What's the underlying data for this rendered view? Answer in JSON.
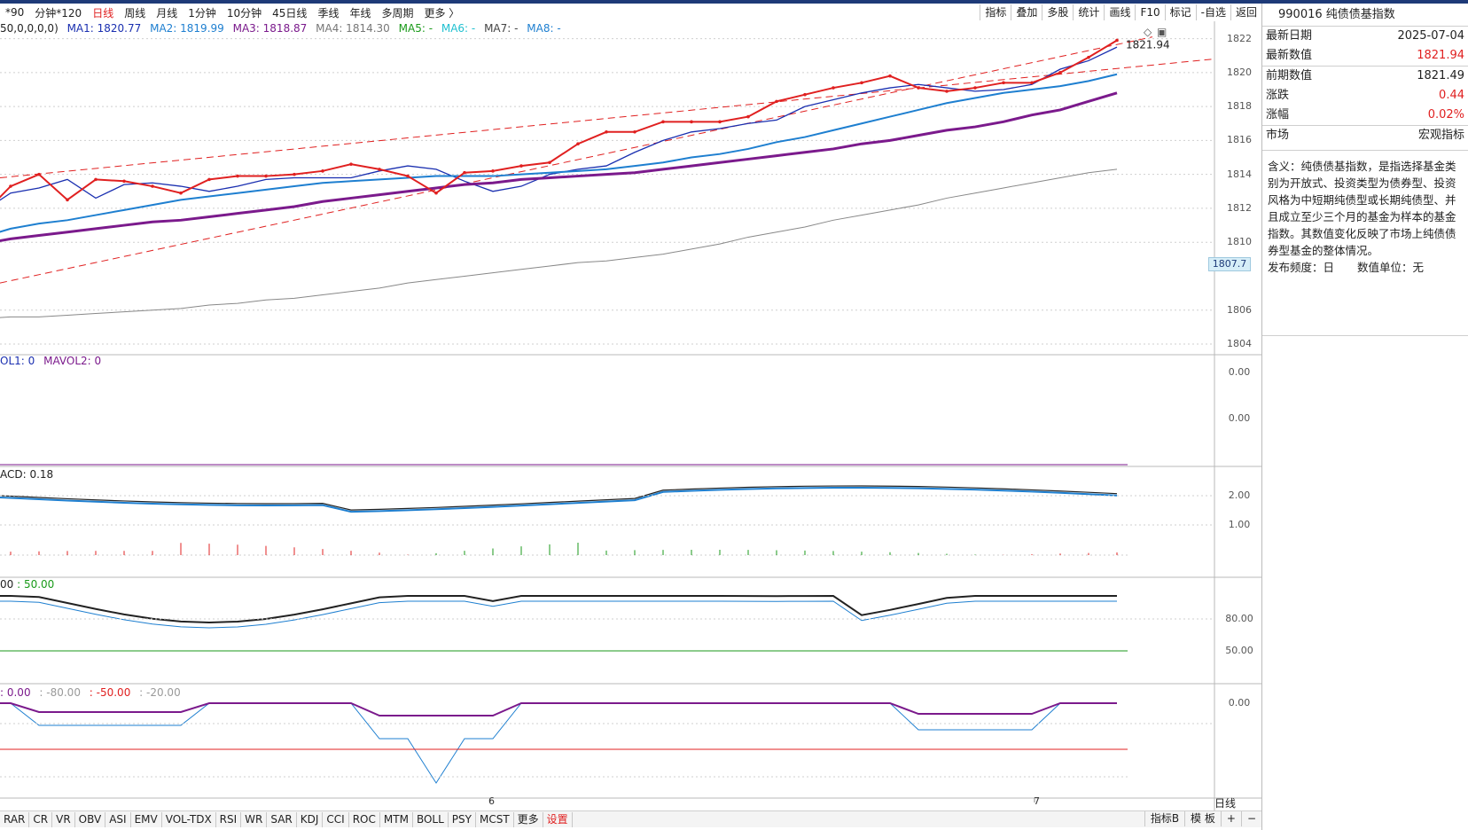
{
  "period_bar": {
    "items": [
      "分钟*120",
      "日线",
      "周线",
      "月线",
      "1分钟",
      "10分钟",
      "45日线",
      "季线",
      "年线",
      "多周期",
      "更多 〉"
    ],
    "prefix": "*90",
    "active": "日线"
  },
  "tool_bar": [
    "指标",
    "叠加",
    "多股",
    "统计",
    "画线",
    "F10",
    "标记",
    "-自选",
    "返回"
  ],
  "legend": {
    "ma": {
      "params": "50,0,0,0,0)",
      "ma1": "MA1: 1820.77",
      "ma2": "MA2: 1819.99",
      "ma3": "MA3: 1818.87",
      "ma4": "MA4: 1814.30",
      "ma5": "MA5: -",
      "ma6": "MA6: -",
      "ma7": "MA7: -",
      "ma8": "MA8: -"
    },
    "vol": {
      "vol1": "OL1: 0",
      "mavol2": "MAVOL2: 0"
    },
    "macd": {
      "macd": "ACD: 0.18"
    },
    "osc": {
      "a": "00",
      "b": ": 50.00"
    },
    "wr": {
      "a": ": 0.00",
      "b": ": -80.00",
      "c": ": -50.00",
      "d": ": -20.00"
    }
  },
  "price_axis": [
    "1822",
    "1820",
    "1818",
    "1816",
    "1814",
    "1812",
    "1810",
    "1806",
    "1804"
  ],
  "price_tag": "1807.7",
  "last_price_label": "1821.94",
  "vol_axis": [
    "0.00",
    "0.00"
  ],
  "macd_axis": [
    "2.00",
    "1.00"
  ],
  "osc_axis": [
    "80.00",
    "50.00"
  ],
  "wr_axis": [
    "0.00"
  ],
  "x_axis": {
    "period": "日线",
    "ticks": [
      "6",
      "7"
    ]
  },
  "bottom_tabs": [
    "RAR",
    "CR",
    "VR",
    "OBV",
    "ASI",
    "EMV",
    "VOL-TDX",
    "RSI",
    "WR",
    "SAR",
    "KDJ",
    "CCI",
    "ROC",
    "MTM",
    "BOLL",
    "PSY",
    "MCST",
    "更多",
    "设置"
  ],
  "bottom_right": [
    "指标B",
    "模 板",
    "+",
    "−"
  ],
  "info": {
    "title": "990016 纯债债基指数",
    "latest_date_label": "最新日期",
    "latest_date": "2025-07-04",
    "latest_value_label": "最新数值",
    "latest_value": "1821.94",
    "prev_value_label": "前期数值",
    "prev_value": "1821.49",
    "change_label": "涨跌",
    "change": "0.44",
    "change_pct_label": "涨幅",
    "change_pct": "0.02%",
    "market_label": "市场",
    "market": "宏观指标",
    "description": "含义：纯债债基指数，是指选择基金类别为开放式、投资类型为债券型、投资风格为中短期纯债型或长期纯债型、并且成立至少三个月的基金为样本的基金指数。其数值变化反映了市场上纯债债券型基金的整体情况。",
    "frequency": "发布频度：日",
    "unit": "数值单位：无"
  },
  "colors": {
    "up": "#e02020",
    "ma1": "#1a2fb0",
    "ma2": "#1e7fd0",
    "ma3": "#7b1a8c",
    "ma4": "#888888",
    "accent": "#1e3a78"
  },
  "chart_data": {
    "type": "line",
    "x": [
      1,
      2,
      3,
      4,
      5,
      6,
      7,
      8,
      9,
      10,
      11,
      12,
      13,
      14,
      15,
      16,
      17,
      18,
      19,
      20,
      21,
      22,
      23,
      24,
      25,
      26,
      27,
      28,
      29,
      30,
      31,
      32,
      33,
      34,
      35,
      36,
      37,
      38,
      39,
      40,
      41
    ],
    "series": [
      {
        "name": "MA1",
        "values": [
          1811.8,
          1812.9,
          1813.2,
          1813.7,
          1812.6,
          1813.4,
          1813.5,
          1813.3,
          1813.0,
          1813.3,
          1813.7,
          1813.8,
          1813.8,
          1813.8,
          1814.2,
          1814.5,
          1814.3,
          1813.6,
          1813.0,
          1813.3,
          1814.0,
          1814.3,
          1814.5,
          1815.3,
          1816.0,
          1816.5,
          1816.7,
          1817.0,
          1817.2,
          1818.0,
          1818.4,
          1818.8,
          1819.1,
          1819.3,
          1819.1,
          1818.9,
          1819.0,
          1819.3,
          1820.2,
          1820.7,
          1821.5
        ]
      },
      {
        "name": "MA2",
        "values": [
          1810.3,
          1810.8,
          1811.1,
          1811.3,
          1811.6,
          1811.9,
          1812.2,
          1812.5,
          1812.7,
          1812.9,
          1813.1,
          1813.3,
          1813.5,
          1813.6,
          1813.7,
          1813.8,
          1813.9,
          1813.9,
          1813.9,
          1814.0,
          1814.1,
          1814.2,
          1814.3,
          1814.5,
          1814.7,
          1815.0,
          1815.2,
          1815.5,
          1815.9,
          1816.2,
          1816.6,
          1817.0,
          1817.4,
          1817.8,
          1818.2,
          1818.5,
          1818.8,
          1819.0,
          1819.2,
          1819.5,
          1819.9
        ]
      },
      {
        "name": "MA3",
        "values": [
          1809.9,
          1810.2,
          1810.4,
          1810.6,
          1810.8,
          1811.0,
          1811.2,
          1811.3,
          1811.5,
          1811.7,
          1811.9,
          1812.1,
          1812.4,
          1812.6,
          1812.8,
          1813.0,
          1813.2,
          1813.4,
          1813.5,
          1813.7,
          1813.8,
          1813.9,
          1814.0,
          1814.1,
          1814.3,
          1814.5,
          1814.7,
          1814.9,
          1815.1,
          1815.3,
          1815.5,
          1815.8,
          1816.0,
          1816.3,
          1816.6,
          1816.8,
          1817.1,
          1817.5,
          1817.8,
          1818.3,
          1818.8
        ]
      },
      {
        "name": "MA4",
        "values": [
          1805.5,
          1805.6,
          1805.6,
          1805.7,
          1805.8,
          1805.9,
          1806.0,
          1806.1,
          1806.3,
          1806.4,
          1806.6,
          1806.7,
          1806.9,
          1807.1,
          1807.3,
          1807.6,
          1807.8,
          1808.0,
          1808.2,
          1808.4,
          1808.6,
          1808.8,
          1808.9,
          1809.1,
          1809.3,
          1809.6,
          1809.9,
          1810.3,
          1810.6,
          1810.9,
          1811.3,
          1811.6,
          1811.9,
          1812.2,
          1812.6,
          1812.9,
          1813.2,
          1813.5,
          1813.8,
          1814.1,
          1814.3
        ]
      },
      {
        "name": "1821.94",
        "values": [
          1811.6,
          1813.3,
          1814.0,
          1812.5,
          1813.7,
          1813.6,
          1813.3,
          1812.9,
          1813.7,
          1813.9,
          1813.9,
          1814.0,
          1814.2,
          1814.6,
          1814.3,
          1813.9,
          1812.9,
          1814.1,
          1814.2,
          1814.5,
          1814.7,
          1815.8,
          1816.5,
          1816.5,
          1817.1,
          1817.1,
          1817.1,
          1817.4,
          1818.3,
          1818.7,
          1819.1,
          1819.4,
          1819.8,
          1819.1,
          1818.9,
          1819.1,
          1819.4,
          1819.4,
          1820.0,
          1820.9,
          1821.9
        ]
      }
    ],
    "ylim": [
      1804,
      1822.5
    ]
  }
}
